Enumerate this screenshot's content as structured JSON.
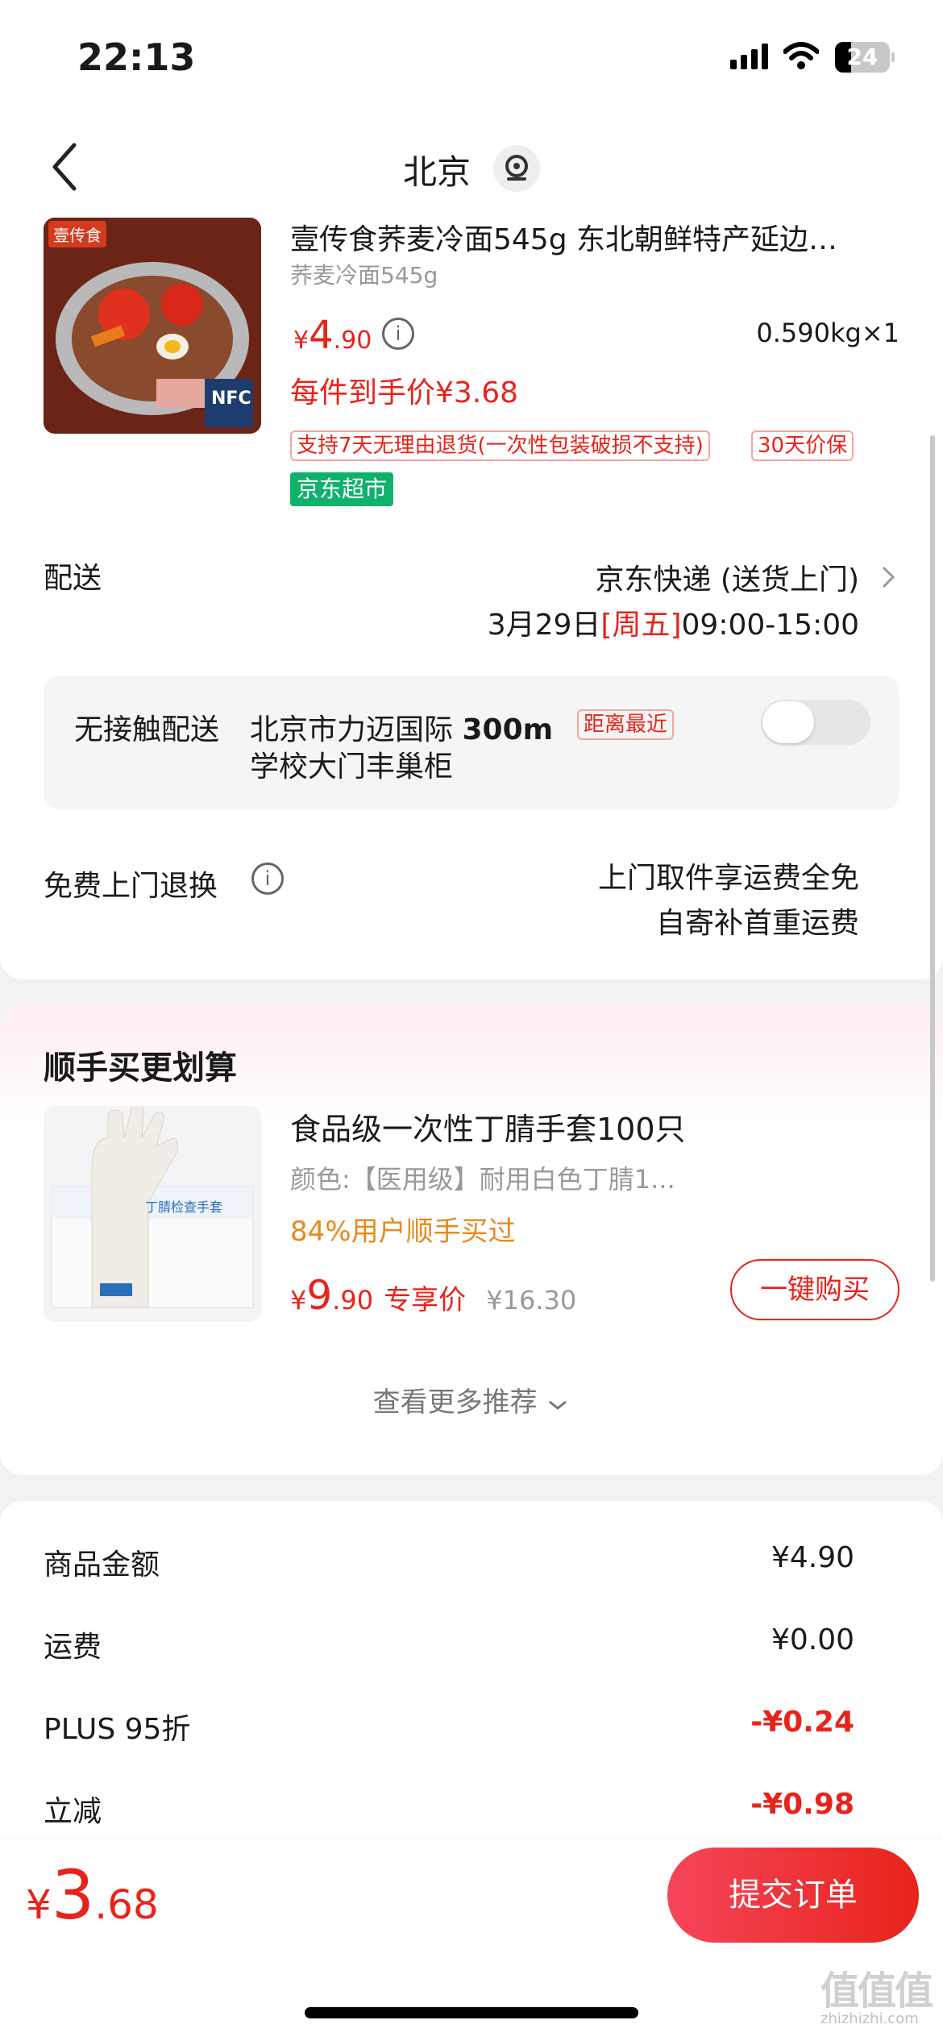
{
  "status_bar": {
    "time": "22:13",
    "battery": "24"
  },
  "header": {
    "city": "北京"
  },
  "product": {
    "title": "壹传食荞麦冷面545g 东北朝鲜特产延边…",
    "spec": "荞麦冷面545g",
    "price_symbol": "¥",
    "price_int": "4",
    "price_dec": ".90",
    "weight_qty": "0.590kg×1",
    "final_price": "每件到手价¥3.68",
    "tag_return": "支持7天无理由退货(一次性包装破损不支持)",
    "tag_price_protect": "30天价保",
    "store_badge": "京东超市",
    "image_brand_text": "壹传食",
    "image_pack_text": "NFC"
  },
  "delivery": {
    "label": "配送",
    "method": "京东快递 (送货上门)",
    "date": "3月29日",
    "weekday": "[周五]",
    "time_range": "09:00-15:00"
  },
  "contactless": {
    "label": "无接触配送",
    "location_line1": "北京市力迈国际",
    "distance": "300m",
    "nearest_tag": "距离最近",
    "location_line2": "学校大门丰巢柜"
  },
  "free_return": {
    "label": "免费上门退换",
    "line1": "上门取件享运费全免",
    "line2": "自寄补首重运费"
  },
  "addon": {
    "section_title": "顺手买更划算",
    "item_title": "食品级一次性丁腈手套100只",
    "item_spec": "颜色:【医用级】耐用白色丁腈1...",
    "social_proof": "84%用户顺手买过",
    "price_symbol": "¥",
    "price_int": "9",
    "price_dec": ".90",
    "exclusive_label": "专享价",
    "original_price": "¥16.30",
    "buy_button": "一键购买",
    "see_more": "查看更多推荐",
    "image_box_text": "丁腈检查手套"
  },
  "summary": {
    "rows": [
      {
        "label": "商品金额",
        "value": "¥4.90"
      },
      {
        "label": "运费",
        "value": "¥0.00"
      },
      {
        "label": "PLUS 95折",
        "value": "-¥0.24"
      },
      {
        "label": "立减",
        "value": "-¥0.98"
      }
    ]
  },
  "footer": {
    "total_symbol": "¥",
    "total_int": "3",
    "total_dec": ".68",
    "submit": "提交订单"
  },
  "watermark": {
    "text": "值值值",
    "url": "zhizhizhi.com"
  },
  "colors": {
    "accent": "#e8231b",
    "store_green": "#0fb26b",
    "panel_gray": "#f5f5f5"
  }
}
